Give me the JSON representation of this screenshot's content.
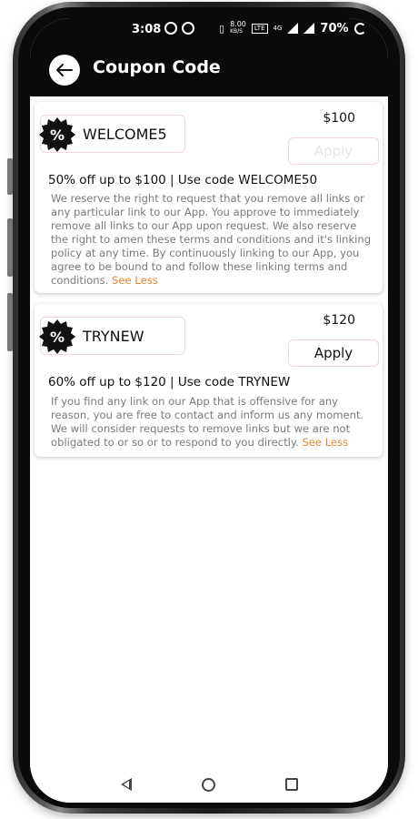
{
  "statusbar": {
    "time": "3:08",
    "speed": "8.00",
    "speed_unit": "KB/S",
    "network_badge": "LTE",
    "network_type": "4G",
    "battery": "70%"
  },
  "appbar": {
    "title": "Coupon Code",
    "back_icon": "arrow-left-icon"
  },
  "coupons": [
    {
      "code": "WELCOME5",
      "price": "$100",
      "apply_label": "Apply",
      "apply_state": "disabled",
      "offer": "50% off up to $100 | Use code WELCOME50",
      "terms": "We reserve the right to request that you remove all links or any particular link to our App. You approve to immediately remove all links to our App upon request. We also reserve the right to amen these terms and conditions and it's linking policy at any time. By continuously linking to our App, you agree to be bound to and follow these linking terms and conditions.",
      "toggle_label": "See Less"
    },
    {
      "code": "TRYNEW",
      "price": "$120",
      "apply_label": "Apply",
      "apply_state": "enabled",
      "offer": "60% off up to $120 | Use code TRYNEW",
      "terms": "If you find any link on our App that is offensive for any reason, you are free to contact and inform us any moment. We will consider requests to remove links but we are not obligated to or so or to respond to you directly.",
      "toggle_label": "See Less"
    }
  ],
  "colors": {
    "appbar_bg": "#0a0a0a",
    "accent_link": "#e8872f",
    "card_border": "#f1d8dd",
    "badge": "#111111"
  }
}
